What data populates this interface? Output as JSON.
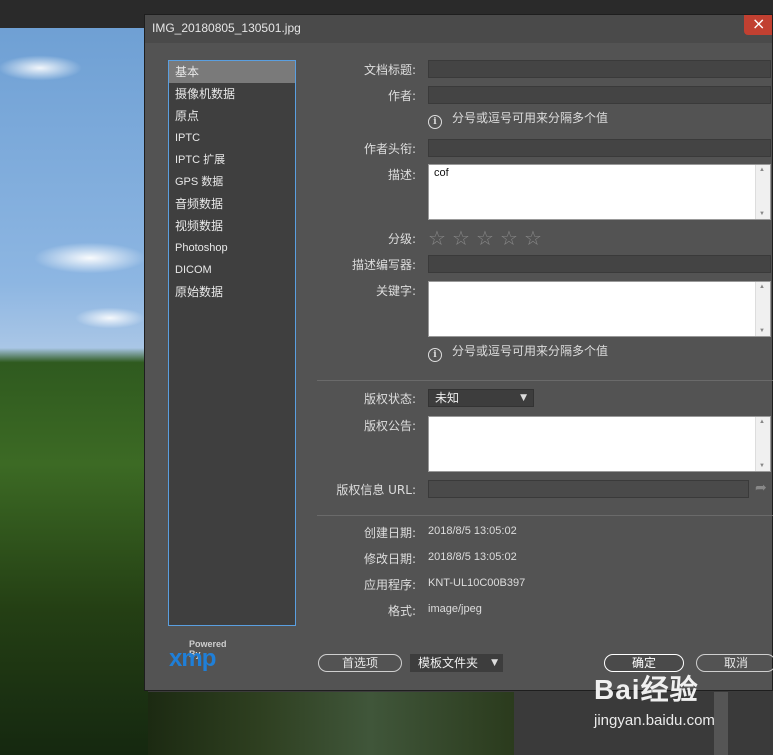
{
  "dialog": {
    "title": "IMG_20180805_130501.jpg"
  },
  "categories": [
    {
      "label": "基本",
      "selected": true
    },
    {
      "label": "摄像机数据"
    },
    {
      "label": "原点"
    },
    {
      "label": "IPTC"
    },
    {
      "label": "IPTC 扩展"
    },
    {
      "label": "GPS 数据"
    },
    {
      "label": "音频数据"
    },
    {
      "label": "视频数据"
    },
    {
      "label": "Photoshop"
    },
    {
      "label": "DICOM"
    },
    {
      "label": "原始数据"
    }
  ],
  "logo": {
    "small": "Powered By",
    "big": "xmp"
  },
  "fields": {
    "doc_title_label": "文档标题:",
    "author_label": "作者:",
    "separator_hint": "分号或逗号可用来分隔多个值",
    "author_title_label": "作者头衔:",
    "description_label": "描述:",
    "description_value": "cof",
    "rating_label": "分级:",
    "rating_value": 0,
    "rating_max": 5,
    "desc_writer_label": "描述编写器:",
    "keywords_label": "关键字:",
    "keywords_hint": "分号或逗号可用来分隔多个值",
    "copyright_status_label": "版权状态:",
    "copyright_status_value": "未知",
    "copyright_notice_label": "版权公告:",
    "copyright_url_label": "版权信息 URL:",
    "created_label": "创建日期:",
    "created_value": "2018/8/5 13:05:02",
    "modified_label": "修改日期:",
    "modified_value": "2018/8/5 13:05:02",
    "app_label": "应用程序:",
    "app_value": "KNT-UL10C00B397",
    "format_label": "格式:",
    "format_value": "image/jpeg"
  },
  "buttons": {
    "preferences": "首选项",
    "template": "模板文件夹",
    "ok": "确定",
    "cancel": "取消"
  },
  "watermark": {
    "main": "Bai经验",
    "sub": "jingyan.baidu.com"
  },
  "colors": {
    "dialog_bg": "#535353",
    "selection_border": "#5a9fe0",
    "xmp_blue": "#1f7fd8",
    "close_red": "#c14031"
  }
}
